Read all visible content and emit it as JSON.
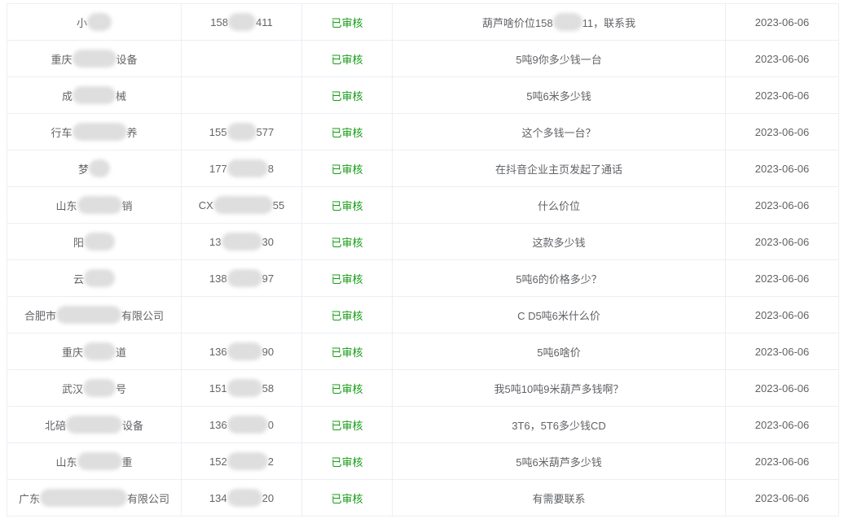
{
  "colors": {
    "status": "#159b15",
    "text": "#606266",
    "border": "#ebeef5"
  },
  "table": {
    "rows": [
      {
        "name": [
          "小",
          ""
        ],
        "phone": [
          "158",
          "411"
        ],
        "status": "已审核",
        "message": [
          "葫芦啥价位158",
          "11，联系我"
        ],
        "date": "2023-06-06"
      },
      {
        "name": [
          "重庆",
          "设备"
        ],
        "phone": "",
        "status": "已审核",
        "message": "5吨9你多少钱一台",
        "date": "2023-06-06"
      },
      {
        "name": [
          "成",
          "械"
        ],
        "phone": "",
        "status": "已审核",
        "message": "5吨6米多少钱",
        "date": "2023-06-06"
      },
      {
        "name": [
          "行车",
          "养"
        ],
        "phone": [
          "155",
          "577"
        ],
        "status": "已审核",
        "message": "这个多钱一台？",
        "date": "2023-06-06"
      },
      {
        "name": [
          "梦",
          ""
        ],
        "phone": [
          "177",
          "8"
        ],
        "status": "已审核",
        "message": "在抖音企业主页发起了通话",
        "date": "2023-06-06"
      },
      {
        "name": [
          "山东",
          "销"
        ],
        "phone": [
          "CX",
          "55"
        ],
        "status": "已审核",
        "message": "什么价位",
        "date": "2023-06-06"
      },
      {
        "name": [
          "阳",
          ""
        ],
        "phone": [
          "13",
          "30"
        ],
        "status": "已审核",
        "message": "这款多少钱",
        "date": "2023-06-06"
      },
      {
        "name": [
          "云",
          ""
        ],
        "phone": [
          "138",
          "97"
        ],
        "status": "已审核",
        "message": "5吨6的价格多少？",
        "date": "2023-06-06"
      },
      {
        "name": [
          "合肥市",
          "有限公司"
        ],
        "phone": "",
        "status": "已审核",
        "message": "C D5吨6米什么价",
        "date": "2023-06-06"
      },
      {
        "name": [
          "重庆",
          "道"
        ],
        "phone": [
          "136",
          "90"
        ],
        "status": "已审核",
        "message": "5吨6啥价",
        "date": "2023-06-06"
      },
      {
        "name": [
          "武汉",
          "号"
        ],
        "phone": [
          "151",
          "58"
        ],
        "status": "已审核",
        "message": "我5吨10吨9米葫芦多钱啊？",
        "date": "2023-06-06"
      },
      {
        "name": [
          "北碚",
          "设备"
        ],
        "phone": [
          "136",
          "0"
        ],
        "status": "已审核",
        "message": "3T6，5T6多少钱CD",
        "date": "2023-06-06"
      },
      {
        "name": [
          "山东",
          "重"
        ],
        "phone": [
          "152",
          "2"
        ],
        "status": "已审核",
        "message": "5吨6米葫芦多少钱",
        "date": "2023-06-06"
      },
      {
        "name": [
          "广东",
          "有限公司"
        ],
        "phone": [
          "134",
          "20"
        ],
        "status": "已审核",
        "message": "有需要联系",
        "date": "2023-06-06"
      }
    ]
  }
}
